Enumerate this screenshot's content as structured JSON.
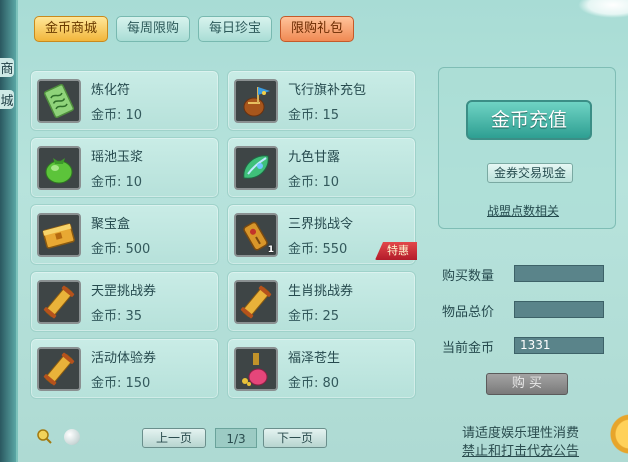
{
  "left_tabs": [
    "商",
    "城"
  ],
  "tabs": [
    {
      "label": "金币商城",
      "active": true
    },
    {
      "label": "每周限购",
      "active": false
    },
    {
      "label": "每日珍宝",
      "active": false
    },
    {
      "label": "限购礼包",
      "active": false
    }
  ],
  "items": [
    {
      "name": "炼化符",
      "price": "金币: 10",
      "icon": "talisman-icon"
    },
    {
      "name": "飞行旗补充包",
      "price": "金币: 15",
      "icon": "flag-pack-icon"
    },
    {
      "name": "瑶池玉浆",
      "price": "金币: 10",
      "icon": "jade-potion-icon"
    },
    {
      "name": "九色甘露",
      "price": "金币: 10",
      "icon": "nectar-icon"
    },
    {
      "name": "聚宝盒",
      "price": "金币: 500",
      "icon": "treasure-box-icon"
    },
    {
      "name": "三界挑战令",
      "price": "金币: 550",
      "icon": "challenge-token-icon",
      "badge": "特惠",
      "count": "1"
    },
    {
      "name": "天罡挑战券",
      "price": "金币: 35",
      "icon": "scroll-icon"
    },
    {
      "name": "生肖挑战券",
      "price": "金币: 25",
      "icon": "scroll-icon"
    },
    {
      "name": "活动体验券",
      "price": "金币: 150",
      "icon": "scroll-icon"
    },
    {
      "name": "福泽苍生",
      "price": "金币: 80",
      "icon": "potion-bottle-icon"
    }
  ],
  "side": {
    "recharge_label": "金币充值",
    "exchange_label": "金券交易现金",
    "alliance_label": "战盟点数相关"
  },
  "form": {
    "qty_label": "购买数量",
    "qty_value": "",
    "total_label": "物品总价",
    "total_value": "",
    "gold_label": "当前金币",
    "gold_value": "1331",
    "buy_label": "购 买"
  },
  "pager": {
    "prev_label": "上一页",
    "page": "1/3",
    "next_label": "下一页"
  },
  "notices": {
    "line1": "请适度娱乐理性消费",
    "line2": "禁止和打击代充公告"
  },
  "colors": {
    "active_tab": "#f2b63b",
    "gift_tab": "#f08a54",
    "recharge": "#2e9f92",
    "badge": "#c3242f"
  }
}
